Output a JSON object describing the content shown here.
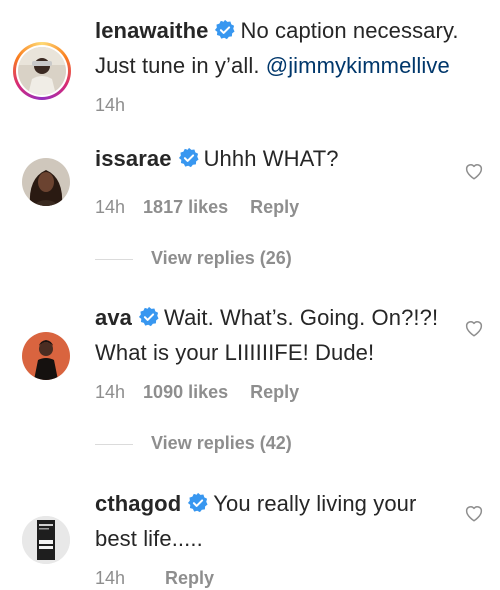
{
  "post": {
    "username": "lenawaithe",
    "caption": "No caption necessary. Just tune in y’all.",
    "mention": "@jimmykimmellive",
    "time": "14h"
  },
  "comments": [
    {
      "username": "issarae",
      "text": "Uhhh WHAT?",
      "time": "14h",
      "likes": "1817 likes",
      "reply": "Reply",
      "view_replies": "View replies (26)"
    },
    {
      "username": "ava",
      "text": "Wait. What’s. Going. On?!?! What is your LIIIIIIFE! Dude!",
      "time": "14h",
      "likes": "1090 likes",
      "reply": "Reply",
      "view_replies": "View replies (42)"
    },
    {
      "username": "cthagod",
      "text": "You really living your best life.....",
      "time": "14h",
      "likes": "",
      "reply": "Reply"
    }
  ],
  "icons": {
    "verified": "verified-badge-icon",
    "heart": "heart-outline-icon"
  },
  "colors": {
    "verified": "#3897f0",
    "mention": "#00376b",
    "meta": "#8e8e8e"
  }
}
